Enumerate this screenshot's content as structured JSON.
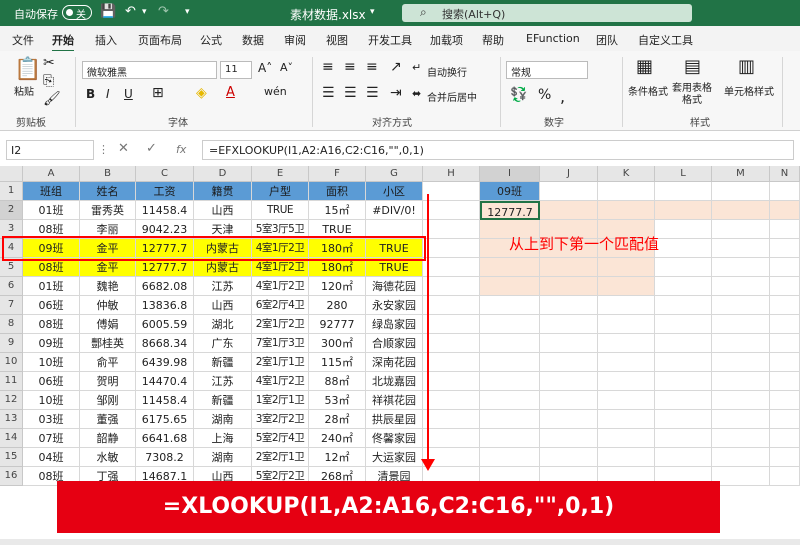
{
  "titlebar": {
    "autosave_label": "自动保存",
    "toggle_state": "关",
    "filename": "素材数据.xlsx",
    "search_placeholder": "搜索(Alt+Q)"
  },
  "menu": [
    "文件",
    "开始",
    "插入",
    "页面布局",
    "公式",
    "数据",
    "审阅",
    "视图",
    "开发工具",
    "加载项",
    "帮助",
    "EFunction",
    "团队",
    "自定义工具"
  ],
  "ribbon": {
    "paste": "粘贴",
    "clipboard": "剪贴板",
    "font_name": "微软雅黑",
    "font_size": "11",
    "font_group": "字体",
    "wrap_text": "自动换行",
    "merge_center": "合并后居中",
    "align_group": "对齐方式",
    "number_format": "常规",
    "number_group": "数字",
    "conditional_format": "条件格式",
    "table_format": "套用表格格式",
    "cell_style": "单元格样式",
    "style_group": "样式"
  },
  "formula_bar": {
    "name_box": "I2",
    "formula": "=EFXLOOKUP(I1,A2:A16,C2:C16,\"\",0,1)"
  },
  "sheet": {
    "columns": [
      "A",
      "B",
      "C",
      "D",
      "E",
      "F",
      "G",
      "H",
      "I",
      "J",
      "K",
      "L",
      "M",
      "N"
    ],
    "headers": [
      "班组",
      "姓名",
      "工资",
      "籍贯",
      "户型",
      "面积",
      "小区"
    ],
    "rows": [
      [
        "01班",
        "雷秀英",
        "11458.4",
        "山西",
        "TRUE",
        "15㎡",
        "#DIV/0!"
      ],
      [
        "08班",
        "李丽",
        "9042.23",
        "天津",
        "5室3厅5卫",
        "TRUE",
        ""
      ],
      [
        "09班",
        "金平",
        "12777.7",
        "内蒙古",
        "4室1厅2卫",
        "180㎡",
        "TRUE"
      ],
      [
        "08班",
        "金平",
        "12777.7",
        "内蒙古",
        "4室1厅2卫",
        "180㎡",
        "TRUE"
      ],
      [
        "01班",
        "魏艳",
        "6682.08",
        "江苏",
        "4室1厅2卫",
        "120㎡",
        "海德花园"
      ],
      [
        "06班",
        "仲敏",
        "13836.8",
        "山西",
        "6室2厅4卫",
        "280",
        "永安家园"
      ],
      [
        "08班",
        "傅娟",
        "6005.59",
        "湖北",
        "2室1厅2卫",
        "92777",
        "绿岛家园"
      ],
      [
        "09班",
        "酆桂英",
        "8668.34",
        "广东",
        "7室1厅3卫",
        "300㎡",
        "合顺家园"
      ],
      [
        "10班",
        "俞平",
        "6439.98",
        "新疆",
        "2室1厅1卫",
        "115㎡",
        "深南花园"
      ],
      [
        "06班",
        "贺明",
        "14470.4",
        "江苏",
        "4室1厅2卫",
        "88㎡",
        "北垅嘉园"
      ],
      [
        "10班",
        "邹刚",
        "11458.4",
        "新疆",
        "1室2厅1卫",
        "53㎡",
        "祥祺花园"
      ],
      [
        "03班",
        "董强",
        "6175.65",
        "湖南",
        "3室2厅2卫",
        "28㎡",
        "拱辰星园"
      ],
      [
        "07班",
        "韶静",
        "6641.68",
        "上海",
        "5室2厅4卫",
        "240㎡",
        "佟馨家园"
      ],
      [
        "04班",
        "水敏",
        "7308.2",
        "湖南",
        "2室2厅1卫",
        "12㎡",
        "大运家园"
      ],
      [
        "08班",
        "丁强",
        "14687.1",
        "山西",
        "5室2厅2卫",
        "268㎡",
        "清景园"
      ]
    ],
    "row_numbers": [
      "1",
      "2",
      "3",
      "4",
      "5",
      "6",
      "7",
      "8",
      "9",
      "10",
      "11",
      "12",
      "13",
      "14",
      "15",
      "16"
    ],
    "lookup_key": "09班",
    "lookup_result": "12777.7",
    "annotation": "从上到下第一个匹配值",
    "banner_formula": "=XLOOKUP(I1,A2:A16,C2:C16,\"\",0,1)"
  },
  "colors": {
    "excel_green": "#217346",
    "header_blue": "#5b9bd5",
    "highlight_yellow": "#ffff00",
    "red": "#ff0000",
    "peach": "#fbe5d6",
    "banner_red": "#e60012"
  }
}
